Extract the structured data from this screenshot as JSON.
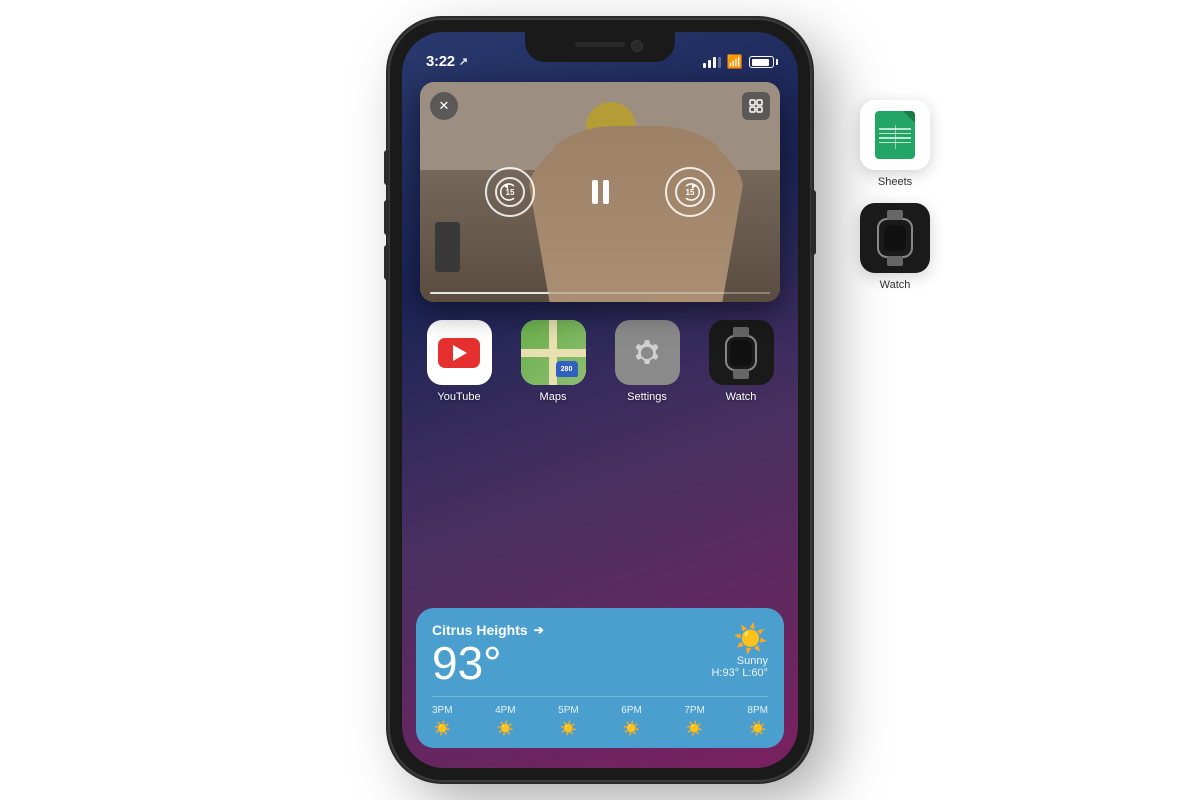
{
  "status_bar": {
    "time": "3:22",
    "location_arrow": "↗"
  },
  "pip": {
    "close_label": "✕",
    "expand_label": "⛶",
    "skip_back_seconds": "15",
    "skip_forward_seconds": "15",
    "progress_percent": 35
  },
  "apps": [
    {
      "id": "youtube",
      "label": "YouTube"
    },
    {
      "id": "maps",
      "label": "Maps"
    },
    {
      "id": "settings",
      "label": "Settings"
    },
    {
      "id": "watch",
      "label": "Watch"
    }
  ],
  "side_apps": [
    {
      "id": "sheets",
      "label": "Sheets"
    },
    {
      "id": "watch2",
      "label": "Watch"
    }
  ],
  "weather": {
    "city": "Citrus Heights",
    "temperature": "93°",
    "condition": "Sunny",
    "high": "H:93°",
    "low": "L:60°",
    "hourly": [
      {
        "time": "3PM",
        "icon": "☀️"
      },
      {
        "time": "4PM",
        "icon": "☀️"
      },
      {
        "time": "5PM",
        "icon": "☀️"
      },
      {
        "time": "6PM",
        "icon": "☀️"
      },
      {
        "time": "7PM",
        "icon": "☀️"
      },
      {
        "time": "8PM",
        "icon": "☀️"
      }
    ]
  },
  "colors": {
    "weather_bg": "#4a9fcf",
    "youtube_red": "#e63030",
    "sheets_green": "#23a566",
    "maps_blue": "#3060c0",
    "settings_gray": "#8a8a8a",
    "watch_black": "#1a1a1a"
  }
}
